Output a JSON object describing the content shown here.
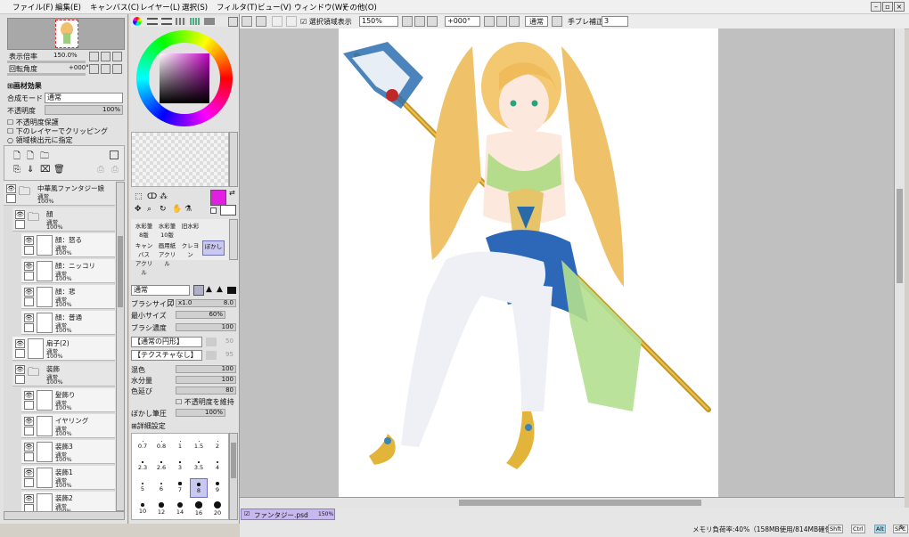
{
  "menu": [
    "ファイル(F)",
    "編集(E)",
    "キャンバス(C)",
    "レイヤー(L)",
    "選択(S)",
    "フィルタ(T)",
    "ビュー(V)",
    "ウィンドウ(W)",
    "その他(O)"
  ],
  "navigator": {
    "zoom_label": "表示倍率",
    "zoom_value": "150.0%",
    "rotate_label": "回転角度",
    "rotate_value": "+000°"
  },
  "effects": {
    "header": "画材効果",
    "blend_label": "合成モード",
    "blend_value": "通常",
    "opacity_label": "不透明度",
    "opacity_value": "100%"
  },
  "layer_options": [
    "不透明度保護",
    "下のレイヤーでクリッピング",
    "領域検出元に指定"
  ],
  "layers": [
    {
      "name": "中華風ファンタジー娘",
      "mode": "通常",
      "opacity": "100%",
      "type": "folder",
      "indent": 0
    },
    {
      "name": "顔",
      "mode": "通常",
      "opacity": "100%",
      "type": "folder",
      "indent": 1
    },
    {
      "name": "顔：怒る",
      "mode": "通常",
      "opacity": "100%",
      "type": "layer",
      "indent": 2
    },
    {
      "name": "顔：ニッコリ",
      "mode": "通常",
      "opacity": "100%",
      "type": "layer",
      "indent": 2
    },
    {
      "name": "顔：悲",
      "mode": "通常",
      "opacity": "100%",
      "type": "layer",
      "indent": 2
    },
    {
      "name": "顔：普通",
      "mode": "通常",
      "opacity": "100%",
      "type": "layer",
      "indent": 2
    },
    {
      "name": "扇子(2)",
      "mode": "通常",
      "opacity": "100%",
      "type": "layer",
      "indent": 1
    },
    {
      "name": "装飾",
      "mode": "通常",
      "opacity": "100%",
      "type": "folder",
      "indent": 1
    },
    {
      "name": "髪飾り",
      "mode": "通常",
      "opacity": "100%",
      "type": "layer",
      "indent": 2
    },
    {
      "name": "イヤリング",
      "mode": "通常",
      "opacity": "100%",
      "type": "layer",
      "indent": 2
    },
    {
      "name": "装飾3",
      "mode": "通常",
      "opacity": "100%",
      "type": "layer",
      "indent": 2
    },
    {
      "name": "装飾1",
      "mode": "通常",
      "opacity": "100%",
      "type": "layer",
      "indent": 2
    },
    {
      "name": "装飾2",
      "mode": "通常",
      "opacity": "100%",
      "type": "layer",
      "indent": 2
    }
  ],
  "toolbar": {
    "selection_label": "選択領域表示",
    "zoom": "150%",
    "angle": "+000°",
    "mode": "通常",
    "stabilizer_label": "手ブレ補正",
    "stabilizer_value": "3"
  },
  "tools": {
    "brushes": [
      {
        "label": "水彩筆",
        "sub": "8版"
      },
      {
        "label": "水彩筆",
        "sub": "10版"
      },
      {
        "label": "旧水彩",
        "sub": ""
      },
      {
        "label": "キャンバス",
        "sub": "アクリル"
      },
      {
        "label": "画用紙",
        "sub": "アクリル"
      },
      {
        "label": "クレヨン",
        "sub": ""
      },
      {
        "label": "ぼかし",
        "sub": ""
      }
    ],
    "blend_mode": "通常",
    "brush_size_label": "ブラシサイズ",
    "brush_size_mult": "x1.0",
    "brush_size": "8.0",
    "min_size_label": "最小サイズ",
    "min_size": "60%",
    "density_label": "ブラシ濃度",
    "density": "100",
    "shape_value": "【通常の円形】",
    "shape_num": "50",
    "texture_value": "【テクスチャなし】",
    "texture_num": "95",
    "mix_label": "混色",
    "mix": "100",
    "water_label": "水分量",
    "water": "100",
    "stretch_label": "色延び",
    "stretch": "80",
    "keep_opacity_label": "不透明度を維持",
    "blur_label": "ぼかし筆圧",
    "blur": "100%",
    "detail_label": "詳細設定",
    "size_grid": [
      "0.7",
      "0.8",
      "1",
      "1.5",
      "2",
      "2.3",
      "2.6",
      "3",
      "3.5",
      "4",
      "5",
      "6",
      "7",
      "8",
      "9",
      "10",
      "12",
      "14",
      "16",
      "20"
    ]
  },
  "status": {
    "doc_tab": "ファンタジー.psd",
    "doc_zoom": "150%",
    "memory": "メモリ負荷率:40%（158MB使用/814MB確保）",
    "keys": [
      "Shft",
      "Ctrl",
      "Alt",
      "SPC",
      "Any"
    ]
  },
  "colors": {
    "main": "#e01fe0",
    "accent": "#c8b8f0"
  }
}
